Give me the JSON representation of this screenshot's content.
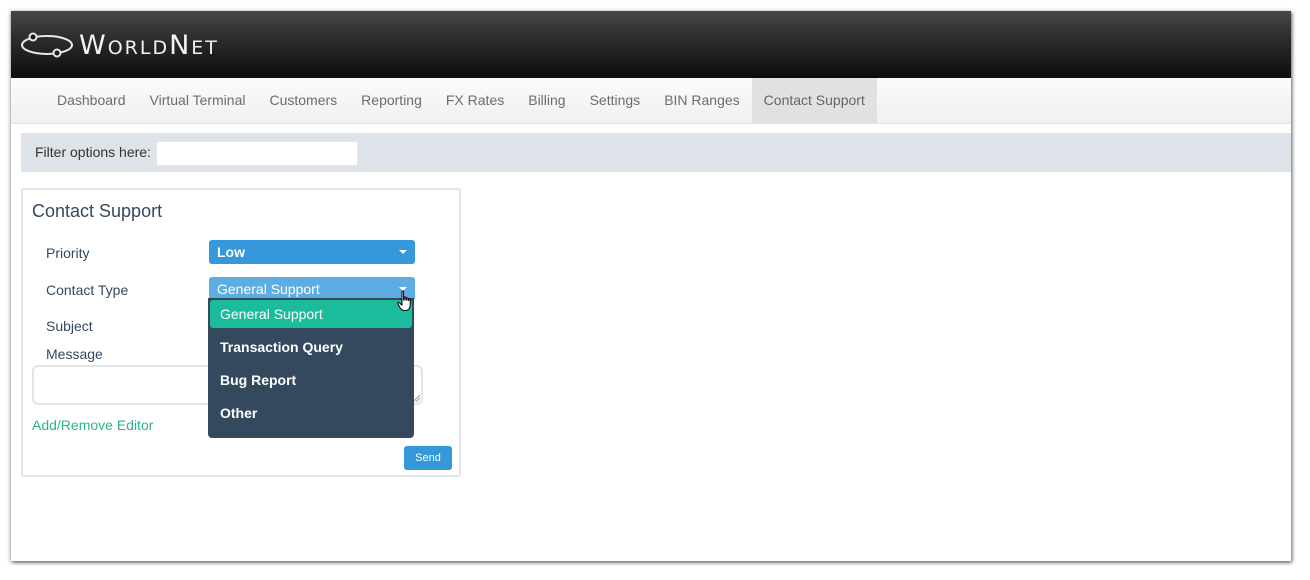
{
  "brand": {
    "name": "WorldNet",
    "logo_icon": "orbit-logo-icon"
  },
  "nav": {
    "items": [
      {
        "label": "Dashboard"
      },
      {
        "label": "Virtual Terminal"
      },
      {
        "label": "Customers"
      },
      {
        "label": "Reporting"
      },
      {
        "label": "FX Rates"
      },
      {
        "label": "Billing"
      },
      {
        "label": "Settings"
      },
      {
        "label": "BIN Ranges"
      },
      {
        "label": "Contact Support",
        "active": true
      }
    ]
  },
  "filter": {
    "label": "Filter options here:",
    "value": ""
  },
  "form": {
    "title": "Contact Support",
    "priority_label": "Priority",
    "priority_value": "Low",
    "contact_type_label": "Contact Type",
    "contact_type_value": "General Support",
    "subject_label": "Subject",
    "message_label": "Message",
    "editor_link": "Add/Remove Editor",
    "send_label": "Send"
  },
  "dropdown": {
    "options": [
      "General Support",
      "Transaction Query",
      "Bug Report",
      "Other"
    ],
    "selected": "General Support"
  },
  "colors": {
    "primary": "#3498db",
    "selected_option": "#1abc9c",
    "dropdown_bg": "#34495e",
    "link": "#2fb28f"
  }
}
